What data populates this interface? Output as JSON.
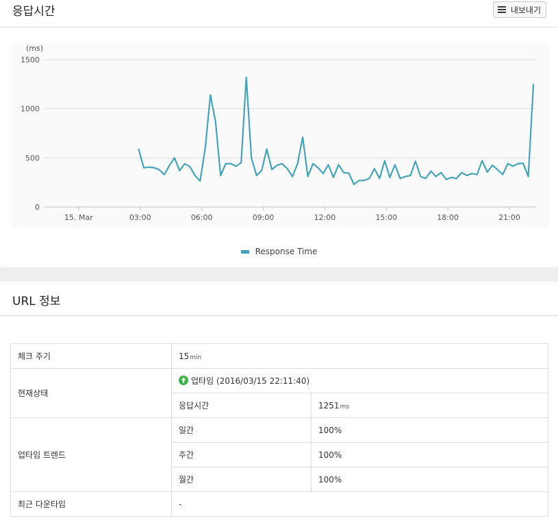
{
  "response_panel": {
    "title": "응답시간",
    "export_label": "내보내기",
    "legend_label": "Response Time"
  },
  "chart_data": {
    "type": "line",
    "y_unit_label": "(ms)",
    "ylim": [
      0,
      1500
    ],
    "y_ticks": [
      0,
      500,
      1000,
      1500
    ],
    "x_tick_labels": [
      "15. Mar",
      "03:00",
      "06:00",
      "09:00",
      "12:00",
      "15:00",
      "18:00",
      "21:00"
    ],
    "x_tick_hours": [
      0,
      3,
      6,
      9,
      12,
      15,
      18,
      21
    ],
    "xlim_hours": [
      -1.7,
      22.3
    ],
    "grid": true,
    "color": "#44a3b8",
    "series": [
      {
        "name": "Response Time",
        "x_hours": [
          2.92,
          3.17,
          3.42,
          3.67,
          3.92,
          4.17,
          4.42,
          4.67,
          4.92,
          5.17,
          5.42,
          5.67,
          5.92,
          6.17,
          6.42,
          6.67,
          6.92,
          7.17,
          7.42,
          7.67,
          7.92,
          8.17,
          8.42,
          8.67,
          8.92,
          9.17,
          9.42,
          9.67,
          9.92,
          10.17,
          10.42,
          10.67,
          10.92,
          11.17,
          11.42,
          11.67,
          11.92,
          12.17,
          12.42,
          12.67,
          12.92,
          13.17,
          13.42,
          13.67,
          13.92,
          14.17,
          14.42,
          14.67,
          14.92,
          15.17,
          15.42,
          15.67,
          15.92,
          16.17,
          16.42,
          16.67,
          16.92,
          17.17,
          17.42,
          17.67,
          17.92,
          18.17,
          18.42,
          18.67,
          18.92,
          19.17,
          19.42,
          19.67,
          19.92,
          20.17,
          20.42,
          20.67,
          20.92,
          21.17,
          21.42,
          21.67,
          21.92,
          22.17
        ],
        "values": [
          590,
          400,
          405,
          400,
          380,
          330,
          420,
          500,
          370,
          440,
          410,
          320,
          265,
          600,
          1140,
          870,
          320,
          440,
          440,
          415,
          450,
          1320,
          500,
          320,
          370,
          590,
          380,
          425,
          440,
          390,
          310,
          440,
          710,
          310,
          440,
          400,
          340,
          430,
          300,
          430,
          350,
          345,
          230,
          270,
          270,
          290,
          390,
          290,
          470,
          300,
          430,
          290,
          310,
          320,
          465,
          310,
          290,
          365,
          310,
          350,
          280,
          300,
          290,
          350,
          320,
          340,
          330,
          470,
          355,
          425,
          380,
          330,
          440,
          415,
          440,
          445,
          310,
          1251
        ]
      }
    ]
  },
  "url_panel": {
    "title": "URL 정보",
    "rows": {
      "check_cycle_label": "체크 주기",
      "check_cycle_value": "15",
      "check_cycle_unit": "min",
      "status_label": "현재상태",
      "status_text": "업타임",
      "status_time": "(2016/03/15 22:11:40)",
      "response_time_label": "응답시간",
      "response_time_value": "1251",
      "response_time_unit": "ms",
      "trend_label": "업타임 트렌드",
      "daily_label": "일간",
      "daily_value": "100%",
      "weekly_label": "주간",
      "weekly_value": "100%",
      "monthly_label": "월간",
      "monthly_value": "100%",
      "downtime_label": "최근 다운타임",
      "downtime_value": "-"
    }
  }
}
